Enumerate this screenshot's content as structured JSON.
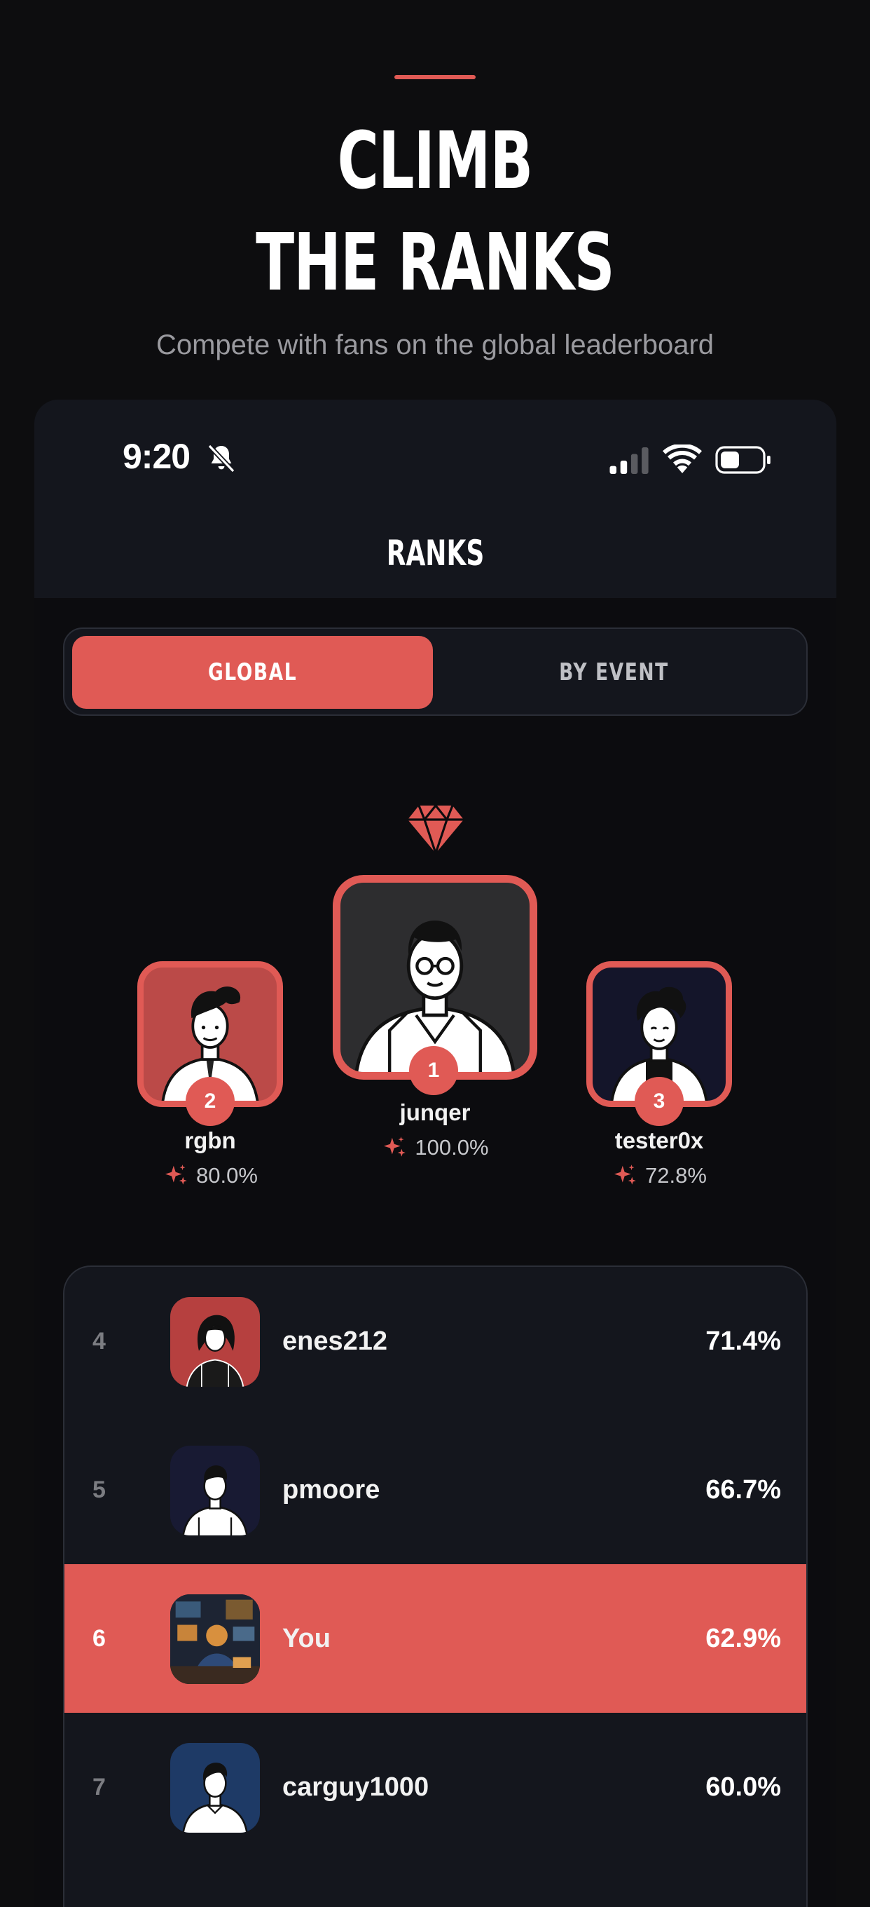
{
  "marketing": {
    "headline_line1": "CLIMB",
    "headline_line2": "THE RANKS",
    "subtitle": "Compete with fans on the global leaderboard"
  },
  "status_bar": {
    "time": "9:20",
    "icons": [
      "bell-slash-icon",
      "cellular-signal-icon",
      "wifi-icon",
      "battery-icon"
    ]
  },
  "screen": {
    "title": "RANKS"
  },
  "tabs": [
    {
      "label": "GLOBAL",
      "selected": true
    },
    {
      "label": "BY EVENT",
      "selected": false
    }
  ],
  "podium": {
    "first": {
      "rank": "1",
      "name": "junqer",
      "score": "100.0%"
    },
    "second": {
      "rank": "2",
      "name": "rgbn",
      "score": "80.0%"
    },
    "third": {
      "rank": "3",
      "name": "tester0x",
      "score": "72.8%"
    }
  },
  "leaderboard": [
    {
      "rank": "4",
      "name": "enes212",
      "score": "71.4%"
    },
    {
      "rank": "5",
      "name": "pmoore",
      "score": "66.7%"
    },
    {
      "rank": "6",
      "name": "You",
      "score": "62.9%",
      "current_user": true
    },
    {
      "rank": "7",
      "name": "carguy1000",
      "score": "60.0%"
    }
  ],
  "colors": {
    "accent": "#e05a55",
    "background": "#0d0d0f",
    "card": "#14161d"
  }
}
